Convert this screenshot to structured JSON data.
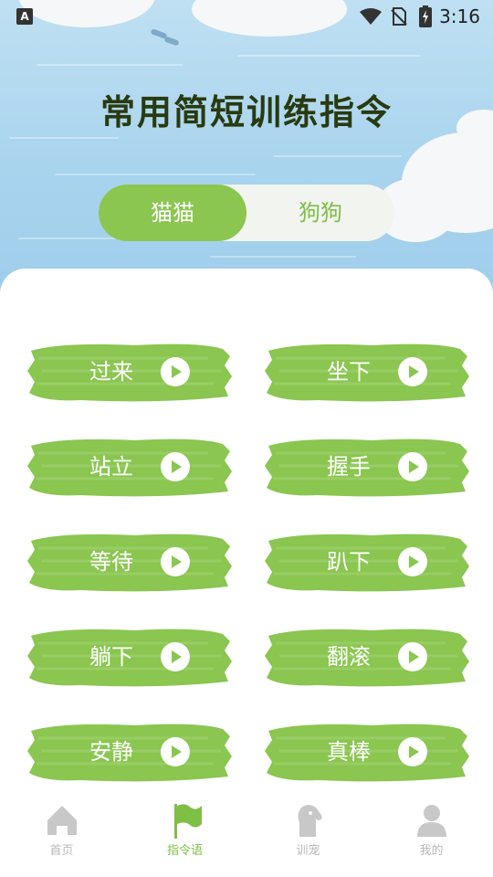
{
  "status_bar": {
    "time": "3:16",
    "notification_icon_letter": "A"
  },
  "header": {
    "title": "常用简短训练指令"
  },
  "tabs": [
    {
      "label": "猫猫",
      "selected": true
    },
    {
      "label": "狗狗",
      "selected": false
    }
  ],
  "commands": [
    {
      "label": "过来"
    },
    {
      "label": "坐下"
    },
    {
      "label": "站立"
    },
    {
      "label": "握手"
    },
    {
      "label": "等待"
    },
    {
      "label": "趴下"
    },
    {
      "label": "躺下"
    },
    {
      "label": "翻滚"
    },
    {
      "label": "安静"
    },
    {
      "label": "真棒"
    }
  ],
  "bottom_nav": [
    {
      "label": "首页",
      "icon": "home-icon",
      "active": false
    },
    {
      "label": "指令语",
      "icon": "flag-icon",
      "active": true
    },
    {
      "label": "训宠",
      "icon": "dog-icon",
      "active": false
    },
    {
      "label": "我的",
      "icon": "user-icon",
      "active": false
    }
  ],
  "colors": {
    "accent": "#8ac650",
    "accent_text": "#7fbf45",
    "sky": "#a9d4ee",
    "title": "#283a10",
    "nav_inactive": "#b8b8b8"
  }
}
